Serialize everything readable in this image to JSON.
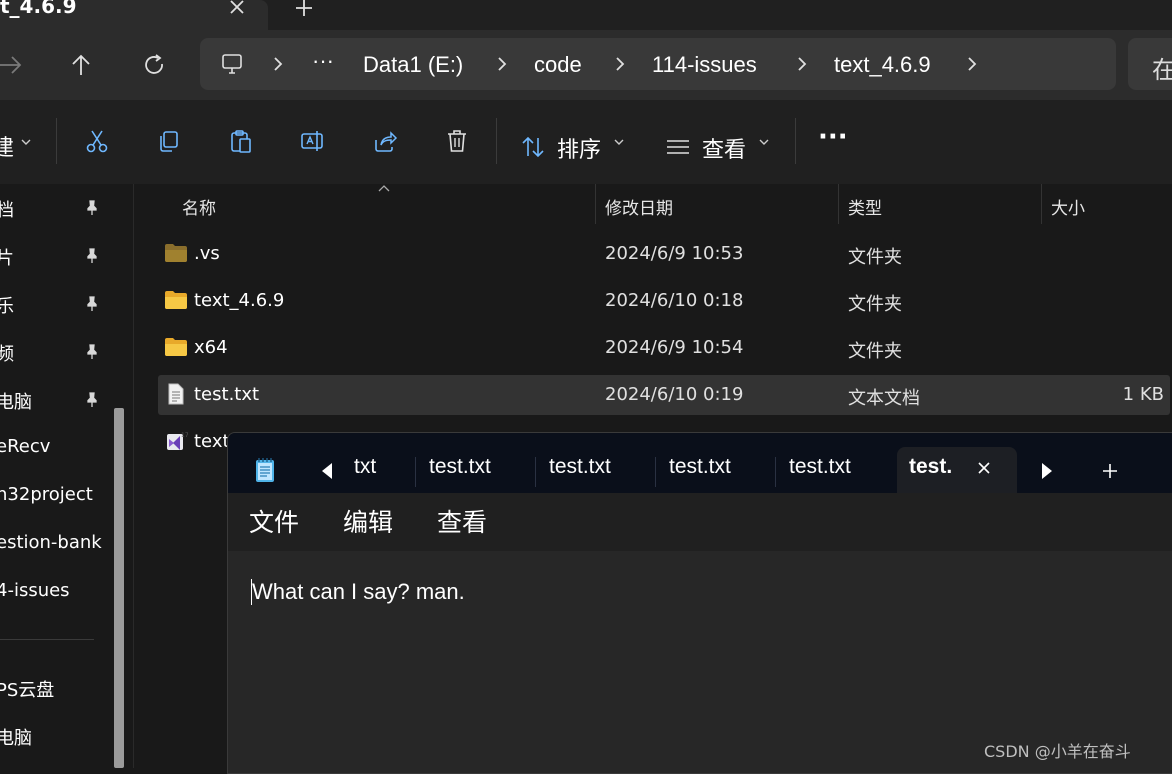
{
  "explorer": {
    "tab": {
      "title": "t_4.6.9"
    },
    "address": {
      "crumbs": [
        "Data1 (E:)",
        "code",
        "114-issues",
        "text_4.6.9"
      ],
      "overflow": "···",
      "search_placeholder": "在"
    },
    "commands": {
      "new_label": "建",
      "sort_label": "排序",
      "view_label": "查看",
      "more": "···"
    },
    "sidebar": {
      "items": [
        "档",
        "片",
        "乐",
        "频",
        "电脑",
        "eRecv",
        "n32project",
        "estion-bank",
        "4-issues",
        "PS云盘",
        "电脑"
      ]
    },
    "columns": {
      "name": "名称",
      "date": "修改日期",
      "type": "类型",
      "size": "大小"
    },
    "files": [
      {
        "name": ".vs",
        "date": "2024/6/9 10:53",
        "type": "文件夹",
        "size": "",
        "icon": "folder-dark-icon"
      },
      {
        "name": "text_4.6.9",
        "date": "2024/6/10 0:18",
        "type": "文件夹",
        "size": "",
        "icon": "folder-icon"
      },
      {
        "name": "x64",
        "date": "2024/6/9 10:54",
        "type": "文件夹",
        "size": "",
        "icon": "folder-icon"
      },
      {
        "name": "test.txt",
        "date": "2024/6/10 0:19",
        "type": "文本文档",
        "size": "1 KB",
        "icon": "text-file-icon",
        "selected": true
      },
      {
        "name": "text",
        "date": "",
        "type": "",
        "size": "",
        "icon": "visual-studio-icon"
      }
    ]
  },
  "notepad": {
    "tabs": [
      "txt",
      "test.txt",
      "test.txt",
      "test.txt",
      "test.txt"
    ],
    "active_tab": "test.",
    "menu": [
      "文件",
      "编辑",
      "查看"
    ],
    "content": "What can I say? man."
  },
  "watermark": "CSDN @小羊在奋斗",
  "colors": {
    "accent": "#0078d4",
    "folder": "#f4c542",
    "selection": "#333333",
    "notepad_tabbar": "#0a0f1a"
  }
}
